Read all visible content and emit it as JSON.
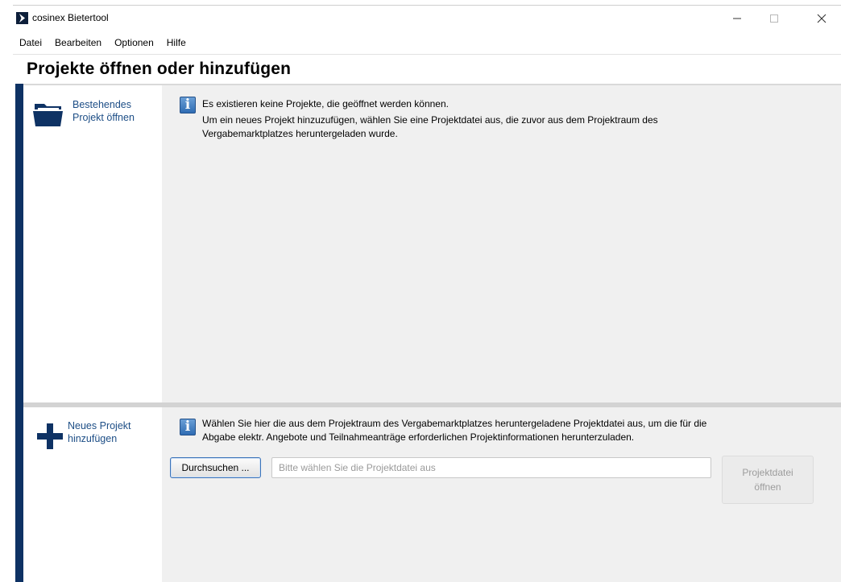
{
  "window": {
    "title": "cosinex Bietertool",
    "controls": {
      "minimize": "—",
      "maximize": "☐",
      "close": "✕"
    }
  },
  "menu": [
    "Datei",
    "Bearbeiten",
    "Optionen",
    "Hilfe"
  ],
  "page": {
    "title": "Projekte öffnen oder hinzufügen"
  },
  "open_section": {
    "label_line1": "Bestehendes",
    "label_line2": "Projekt öffnen",
    "icon": "folder-icon",
    "info_line1": "Es existieren keine Projekte, die geöffnet werden können.",
    "info_line2": "Um ein neues Projekt hinzuzufügen, wählen Sie eine Projektdatei aus, die zuvor aus dem Projektraum des",
    "info_line3": "Vergabemarktplatzes heruntergeladen wurde."
  },
  "new_section": {
    "label_line1": "Neues Projekt",
    "label_line2": "hinzufügen",
    "icon": "plus-icon",
    "info_line1": "Wählen Sie hier die aus dem Projektraum des Vergabemarktplatzes heruntergeladene Projektdatei aus, um die für die",
    "info_line2": "Abgabe elektr. Angebote und Teilnahmeanträge erforderlichen Projektinformationen herunterzuladen.",
    "browse_label": "Durchsuchen ...",
    "file_input_value": "",
    "file_input_placeholder": "Bitte wählen Sie die Projektdatei aus",
    "open_button_line1": "Projektdatei",
    "open_button_line2": "öffnen"
  },
  "colors": {
    "accent": "#0e3264",
    "link": "#1d4e86",
    "panel": "#f0f0f0"
  }
}
